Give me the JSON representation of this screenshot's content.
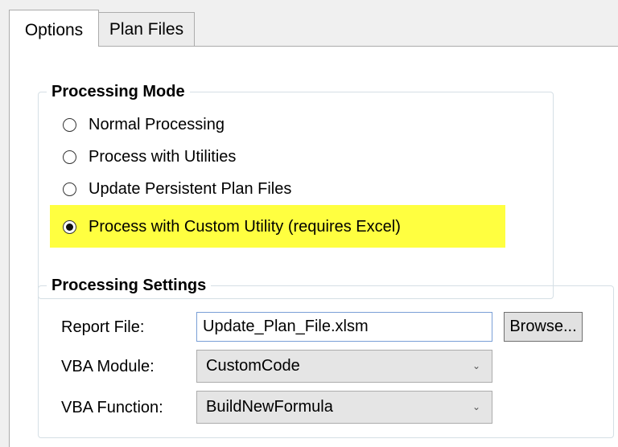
{
  "tabs": [
    {
      "label": "Options",
      "active": true
    },
    {
      "label": "Plan Files",
      "active": false
    }
  ],
  "processing_mode": {
    "title": "Processing Mode",
    "options": [
      {
        "label": "Normal Processing",
        "checked": false
      },
      {
        "label": "Process with Utilities",
        "checked": false
      },
      {
        "label": "Update Persistent Plan Files",
        "checked": false
      },
      {
        "label": "Process with Custom Utility (requires Excel)",
        "checked": true
      }
    ],
    "highlight_color": "#ffff40"
  },
  "processing_settings": {
    "title": "Processing Settings",
    "report_file_label": "Report File:",
    "report_file_value": "Update_Plan_File.xlsm",
    "browse_label": "Browse...",
    "vba_module_label": "VBA Module:",
    "vba_module_value": "CustomCode",
    "vba_function_label": "VBA Function:",
    "vba_function_value": "BuildNewFormula"
  },
  "icons": {
    "dropdown": "chevron-down-icon"
  }
}
